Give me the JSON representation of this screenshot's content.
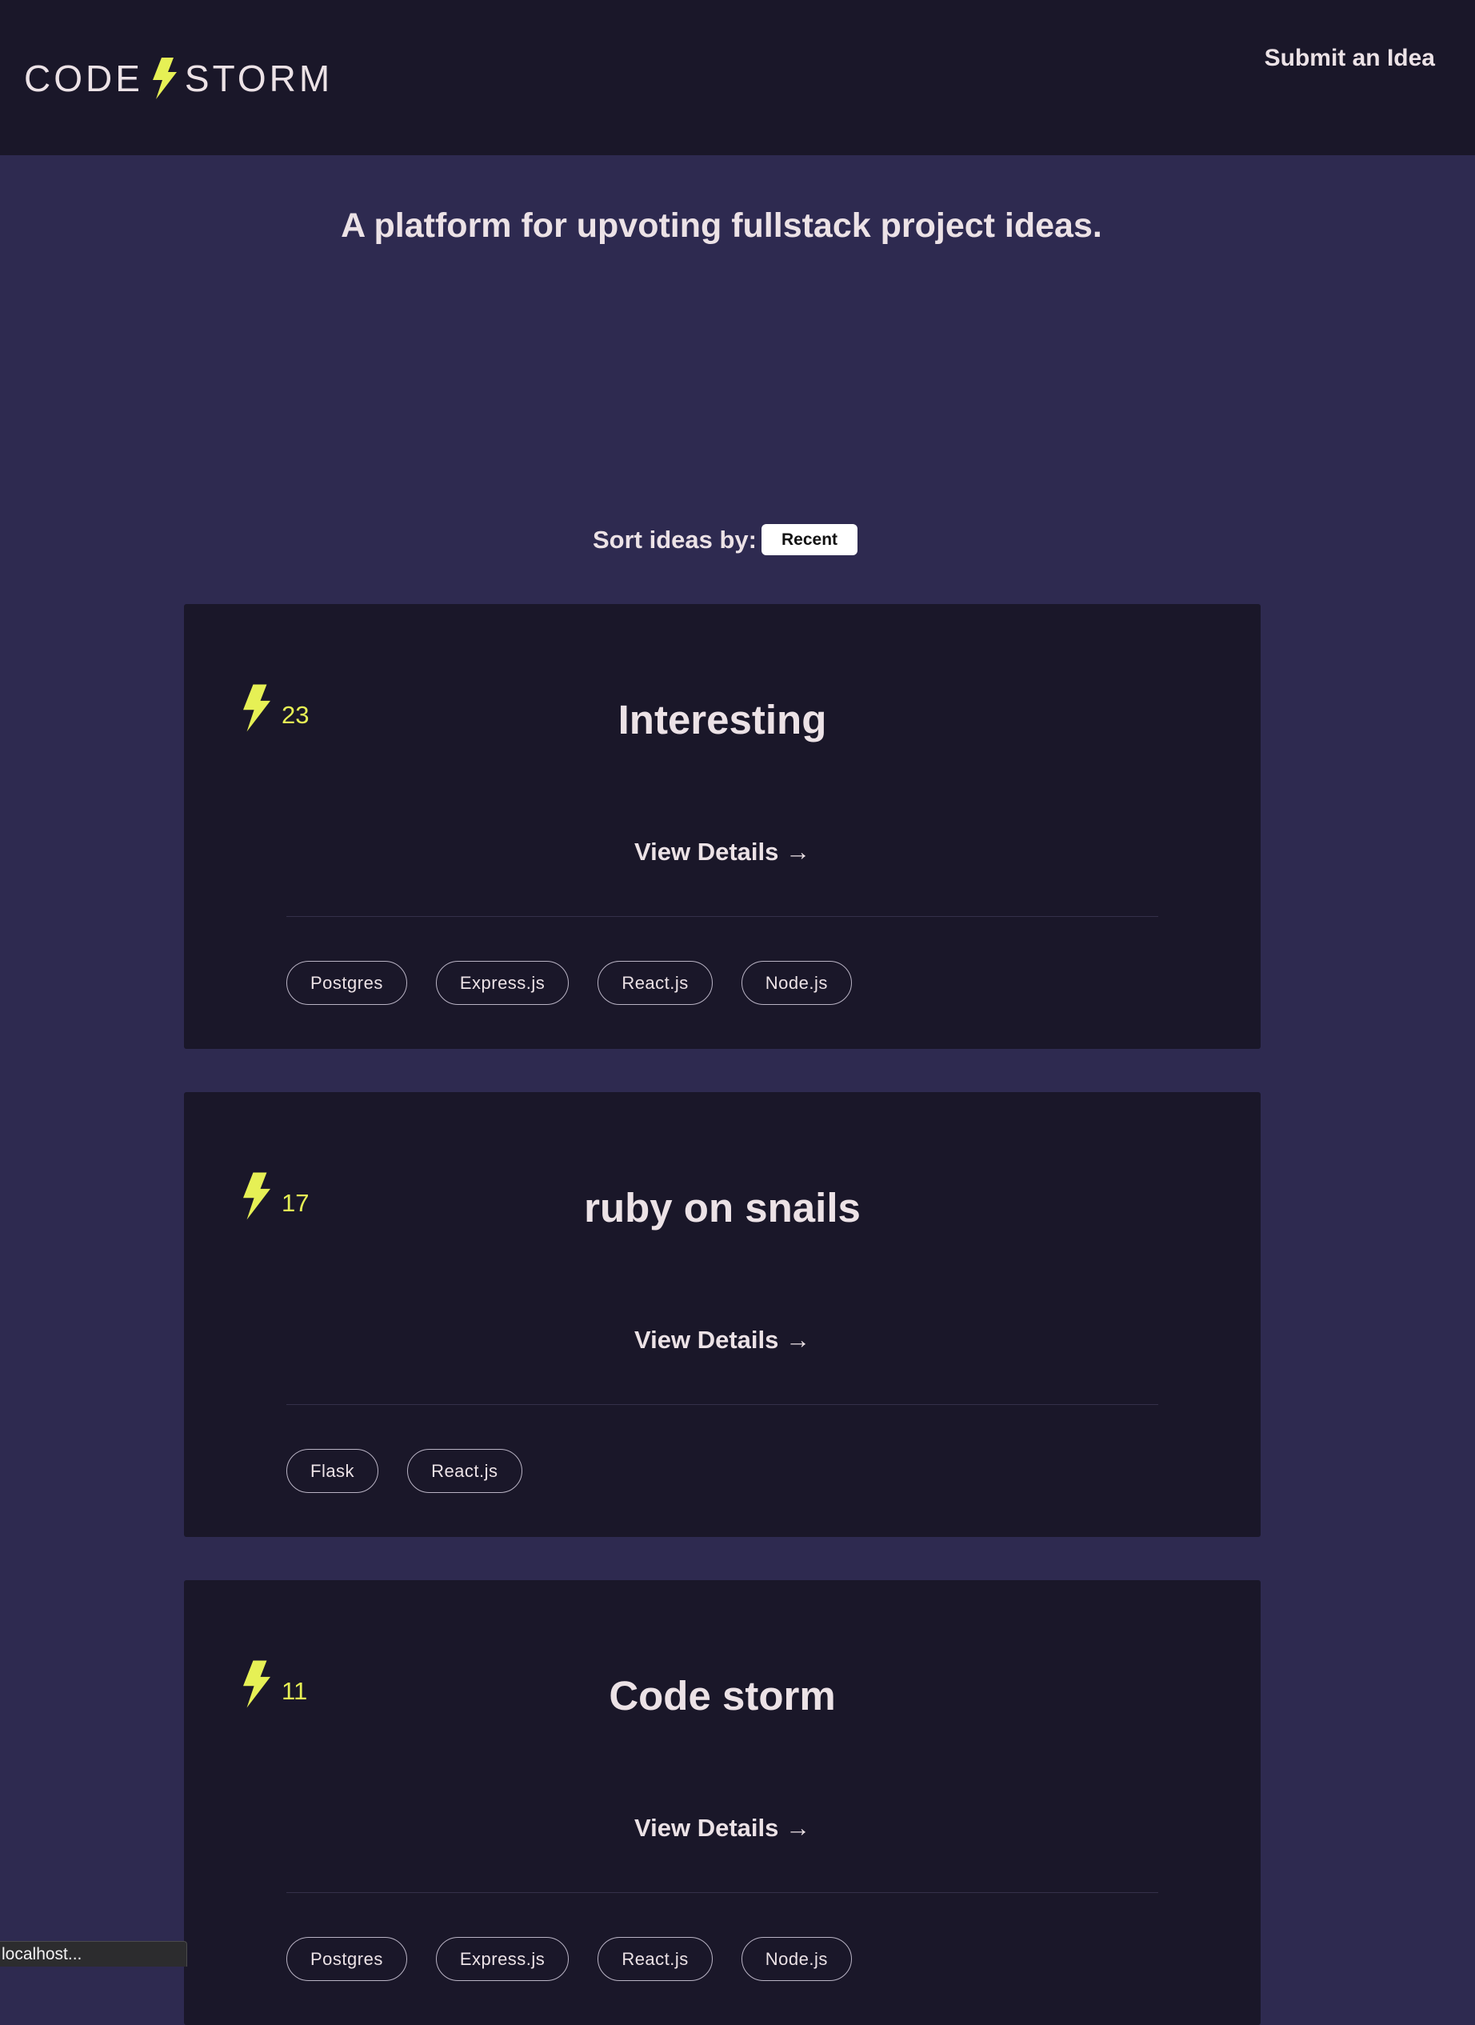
{
  "header": {
    "logo_left": "CODE",
    "logo_right": "STORM",
    "submit_label": "Submit an Idea"
  },
  "colors": {
    "accent_yellow": "#e6f055",
    "page_bg": "#2e2a50",
    "card_bg": "#1a1729",
    "text": "#ece2e6"
  },
  "tagline": "A platform for upvoting fullstack project ideas.",
  "sort": {
    "label": "Sort ideas by:",
    "selected": "Recent"
  },
  "ideas": [
    {
      "votes": "23",
      "title": "Interesting",
      "details_label": "View Details →",
      "tags": [
        "Postgres",
        "Express.js",
        "React.js",
        "Node.js"
      ]
    },
    {
      "votes": "17",
      "title": "ruby on snails",
      "details_label": "View Details →",
      "tags": [
        "Flask",
        "React.js"
      ]
    },
    {
      "votes": "11",
      "title": "Code storm",
      "details_label": "View Details →",
      "tags": [
        "Postgres",
        "Express.js",
        "React.js",
        "Node.js"
      ]
    }
  ],
  "status_bar": {
    "text": "localhost..."
  },
  "icons": {
    "logo": "lightning-bolt-icon",
    "upvote": "lightning-bolt-icon"
  }
}
